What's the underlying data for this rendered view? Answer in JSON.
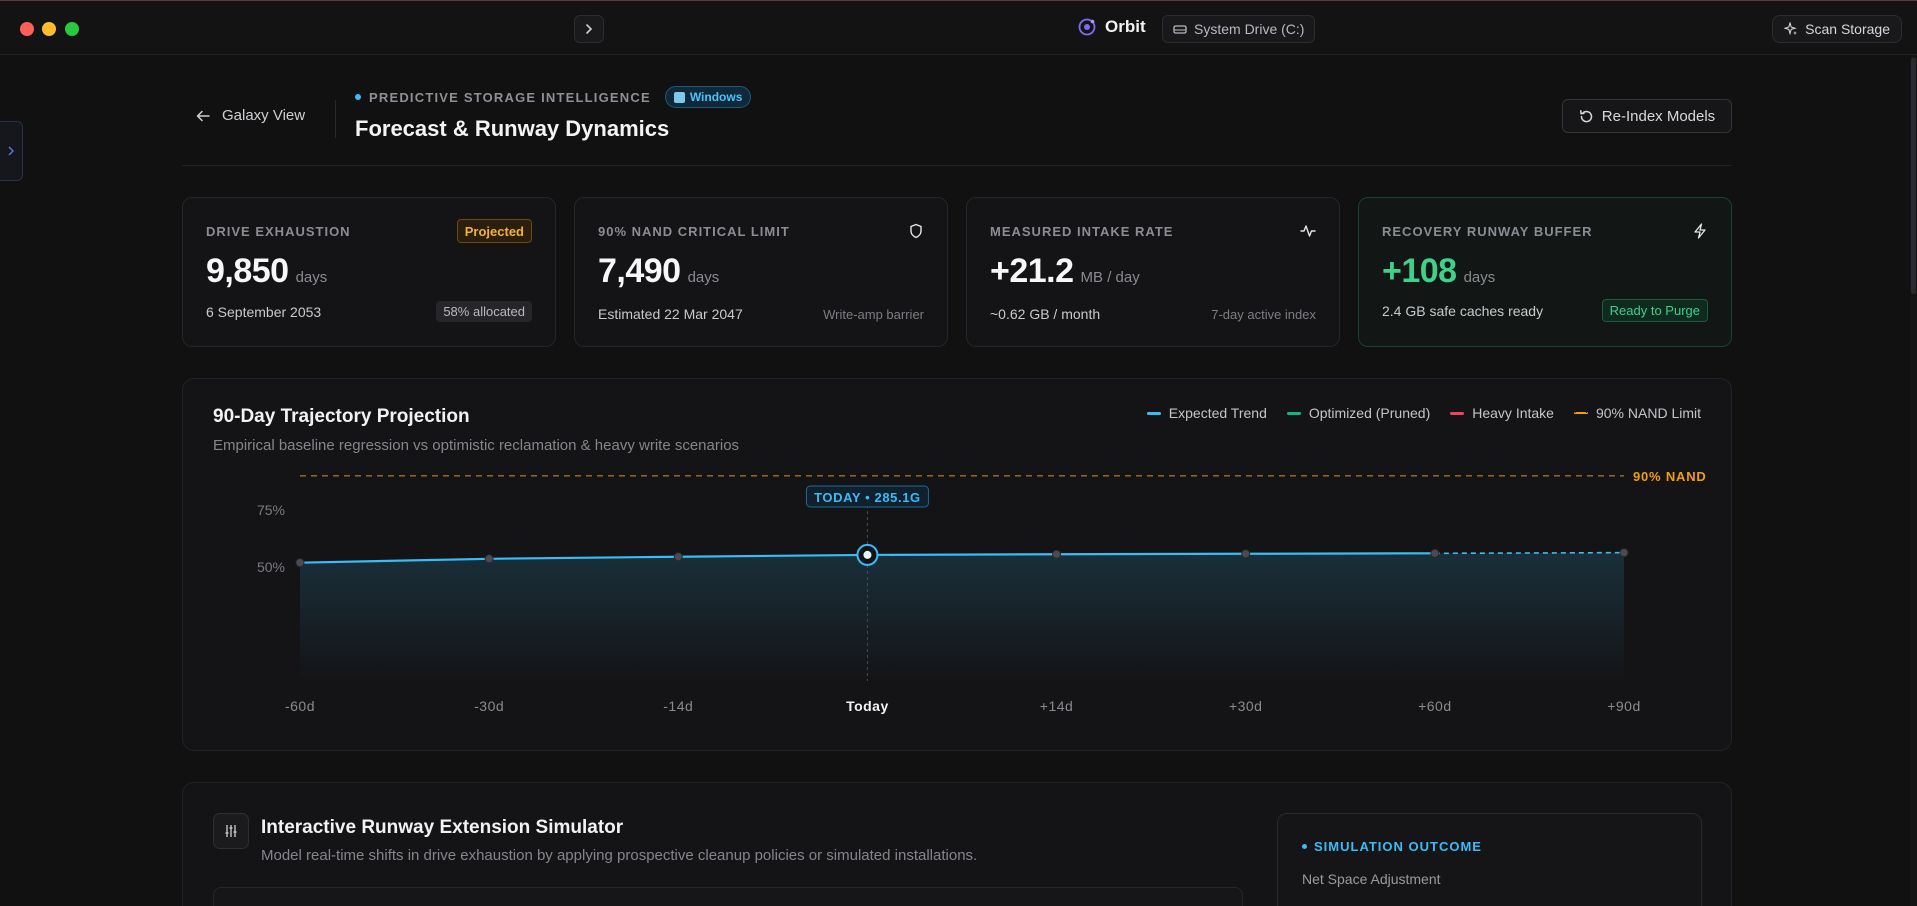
{
  "window": {
    "app_name": "Orbit",
    "drive_chip": "System Drive (C:)",
    "scan_button": "Scan Storage"
  },
  "header": {
    "back_label": "Galaxy View",
    "eyebrow": "PREDICTIVE STORAGE INTELLIGENCE",
    "os_badge": "Windows",
    "title": "Forecast & Runway Dynamics",
    "reindex_button": "Re-Index Models"
  },
  "cards": [
    {
      "label": "DRIVE EXHAUSTION",
      "badge": "Projected",
      "value": "9,850",
      "unit": "days",
      "foot_left": "6 September 2053",
      "foot_right": "58% allocated"
    },
    {
      "label": "90% NAND CRITICAL LIMIT",
      "icon": "shield-icon",
      "value": "7,490",
      "unit": "days",
      "foot_left": "Estimated 22 Mar 2047",
      "foot_right": "Write-amp barrier"
    },
    {
      "label": "MEASURED INTAKE RATE",
      "icon": "activity-icon",
      "value": "+21.2",
      "unit": "MB / day",
      "foot_left": "~0.62 GB / month",
      "foot_right": "7-day active index"
    },
    {
      "label": "RECOVERY RUNWAY BUFFER",
      "icon": "lightning-icon",
      "value": "+108",
      "unit": "days",
      "foot_left": "2.4 GB safe caches ready",
      "foot_right": "Ready to Purge"
    }
  ],
  "chart": {
    "title": "90-Day Trajectory Projection",
    "subtitle": "Empirical baseline regression vs optimistic reclamation & heavy write scenarios",
    "legend": [
      {
        "label": "Expected Trend",
        "color": "#38bdf8"
      },
      {
        "label": "Optimized (Pruned)",
        "color": "#10b981"
      },
      {
        "label": "Heavy Intake",
        "color": "#f43f5e"
      },
      {
        "label": "90% NAND Limit",
        "color": "#f59e0b"
      }
    ],
    "today_label": "TODAY • 285.1G",
    "nand_label": "90% NAND"
  },
  "chart_data": {
    "type": "line",
    "title": "90-Day Trajectory Projection",
    "categories": [
      "-60d",
      "-30d",
      "-14d",
      "Today",
      "+14d",
      "+30d",
      "+60d",
      "+90d"
    ],
    "y_ticks": [
      "75%",
      "50%"
    ],
    "threshold": {
      "name": "90% NAND",
      "value": 90
    },
    "series": [
      {
        "name": "Expected Trend",
        "values": [
          51.9,
          53.6,
          54.5,
          55.3,
          55.6,
          55.8,
          56.0,
          56.3
        ]
      }
    ],
    "highlight": {
      "category": "Today",
      "label": "TODAY • 285.1G"
    },
    "ylim": [
      0,
      100
    ]
  },
  "simulator": {
    "title": "Interactive Runway Extension Simulator",
    "subtitle": "Model real-time shifts in drive exhaustion by applying prospective cleanup policies or simulated installations.",
    "outcome_label": "SIMULATION OUTCOME",
    "net_label": "Net Space Adjustment"
  }
}
